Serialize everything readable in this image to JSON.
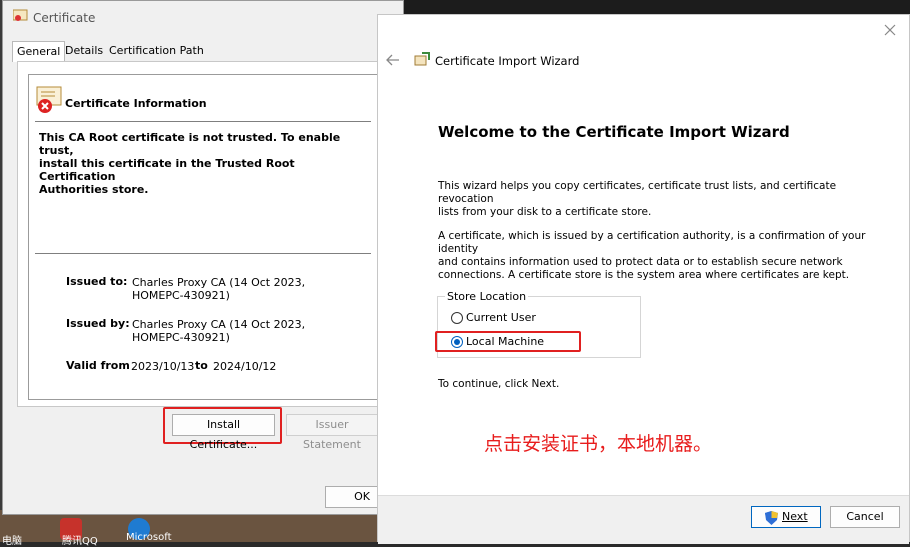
{
  "cert_dialog": {
    "title": "Certificate",
    "tabs": [
      "General",
      "Details",
      "Certification Path"
    ],
    "active_tab": "General",
    "info_heading": "Certificate Information",
    "warning_lines": [
      "This CA Root certificate is not trusted. To enable trust,",
      "install this certificate in the Trusted Root Certification",
      "Authorities store."
    ],
    "issued_to_label": "Issued to:",
    "issued_to_lines": [
      "Charles Proxy CA (14 Oct 2023,",
      "HOMEPC-430921)"
    ],
    "issued_by_label": "Issued by:",
    "issued_by_lines": [
      "Charles Proxy CA (14 Oct 2023,",
      "HOMEPC-430921)"
    ],
    "valid_from_label": "Valid from",
    "valid_from": "2023/10/13",
    "valid_to_label": "to",
    "valid_to": "2024/10/12",
    "install_button": "Install Certificate...",
    "issuer_button": "Issuer Statement",
    "ok_button": "OK"
  },
  "wizard": {
    "title": "Certificate Import Wizard",
    "heading": "Welcome to the Certificate Import Wizard",
    "para1_lines": [
      "This wizard helps you copy certificates, certificate trust lists, and certificate revocation",
      "lists from your disk to a certificate store."
    ],
    "para2_lines": [
      "A certificate, which is issued by a certification authority, is a confirmation of your identity",
      "and contains information used to protect data or to establish secure network",
      "connections. A certificate store is the system area where certificates are kept."
    ],
    "store_location_label": "Store Location",
    "option_current_user": "Current User",
    "option_local_machine": "Local Machine",
    "selected_option": "Local Machine",
    "continue_text": "To continue, click Next.",
    "next_button": "Next",
    "cancel_button": "Cancel"
  },
  "annotation": {
    "note": "点击安装证书，本地机器。",
    "color": "#e81c1c"
  },
  "desktop": {
    "labels": [
      "电脑",
      "腾讯QQ",
      "Microsoft"
    ]
  }
}
